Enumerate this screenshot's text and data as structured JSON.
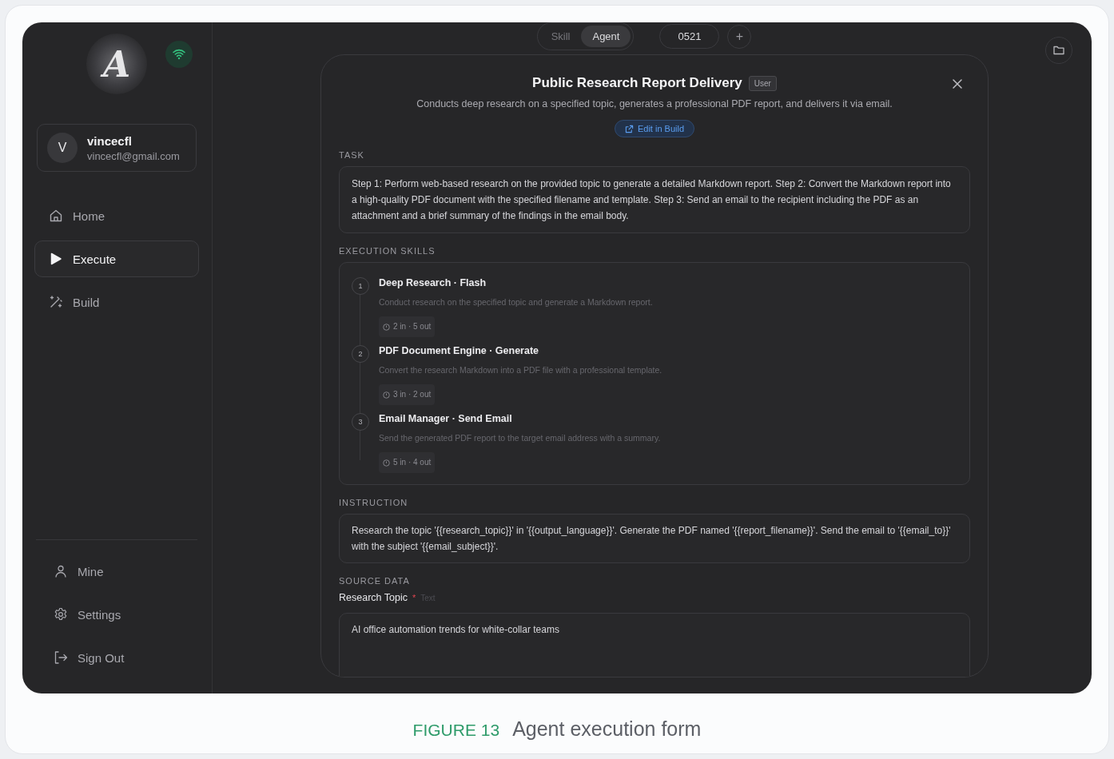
{
  "sidebar": {
    "logo": "A",
    "user": {
      "avatar": "V",
      "name": "vincecfl",
      "email": "vincecfl@gmail.com"
    },
    "nav": [
      {
        "label": "Home",
        "selected": false
      },
      {
        "label": "Execute",
        "selected": true
      },
      {
        "label": "Build",
        "selected": false
      }
    ],
    "footer_nav": [
      {
        "label": "Mine"
      },
      {
        "label": "Settings"
      },
      {
        "label": "Sign Out"
      }
    ]
  },
  "toolbar": {
    "tabs": [
      {
        "label": "Skill",
        "selected": false
      },
      {
        "label": "Agent",
        "selected": true
      }
    ],
    "counter": "0521",
    "add": "+"
  },
  "dialog": {
    "title": "Public Research Report Delivery",
    "badge": "User",
    "description": "Conducts deep research on a specified topic, generates a professional PDF report, and delivers it via email.",
    "edit_button": "Edit in Build",
    "task_label": "TASK",
    "task": "Step 1: Perform web-based research on the provided topic to generate a detailed Markdown report. Step 2: Convert the Markdown report into a high-quality PDF document with the specified filename and template. Step 3: Send an email to the recipient including the PDF as an attachment and a brief summary of the findings in the email body.",
    "skills_label": "EXECUTION SKILLS",
    "skills": [
      {
        "number": "1",
        "title": "Deep Research · Flash",
        "description": "Conduct research on the specified topic and generate a Markdown report.",
        "io": "2 in · 5 out"
      },
      {
        "number": "2",
        "title": "PDF Document Engine · Generate",
        "description": "Convert the research Markdown into a PDF file with a professional template.",
        "io": "3 in · 2 out"
      },
      {
        "number": "3",
        "title": "Email Manager · Send Email",
        "description": "Send the generated PDF report to the target email address with a summary.",
        "io": "5 in · 4 out"
      }
    ],
    "instruction_label": "INSTRUCTION",
    "instruction": "Research the topic '{{research_topic}}' in '{{output_language}}'. Generate the PDF named '{{report_filename}}'. Send the email to '{{email_to}}' with the subject '{{email_subject}}'.",
    "source_label": "SOURCE DATA",
    "fields": [
      {
        "label": "Research Topic",
        "required_mark": "*",
        "type": "Text",
        "value": "AI office automation trends for white-collar teams"
      }
    ]
  },
  "caption": {
    "label": "FIGURE 13",
    "text": "Agent execution form"
  }
}
